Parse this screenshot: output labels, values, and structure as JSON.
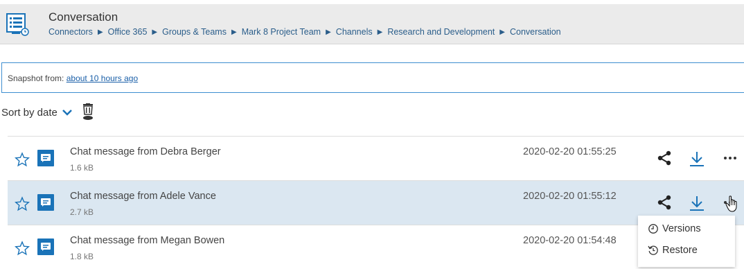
{
  "header": {
    "title": "Conversation",
    "breadcrumb": [
      "Connectors",
      "Office 365",
      "Groups & Teams",
      "Mark 8 Project Team",
      "Channels",
      "Research and Development",
      "Conversation"
    ]
  },
  "snapshot": {
    "label": "Snapshot from: ",
    "link_text": "about 10 hours ago"
  },
  "sort": {
    "label": "Sort by date"
  },
  "items": [
    {
      "name": "Chat message from Debra Berger",
      "size": "1.6 kB",
      "date": "2020-02-20 01:55:25"
    },
    {
      "name": "Chat message from Adele Vance",
      "size": "2.7 kB",
      "date": "2020-02-20 01:55:12"
    },
    {
      "name": "Chat message from Megan Bowen",
      "size": "1.8 kB",
      "date": "2020-02-20 01:54:48"
    }
  ],
  "context_menu": {
    "items": [
      "Versions",
      "Restore"
    ]
  },
  "colors": {
    "accent": "#1a73b8",
    "header_bg": "#ebebeb",
    "row_hover": "#dbe7f1",
    "link": "#1a5fa8"
  }
}
